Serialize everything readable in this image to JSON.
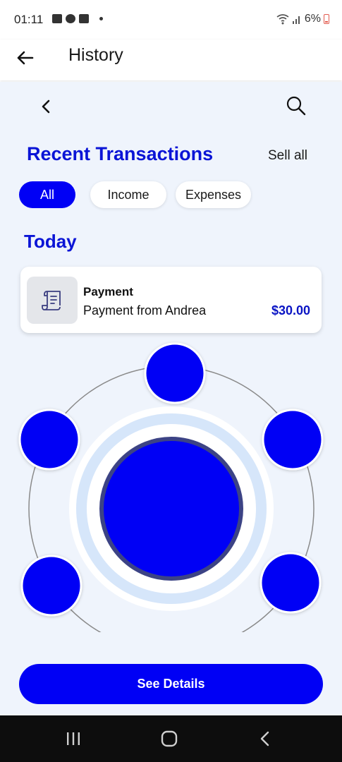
{
  "status": {
    "time": "01:11",
    "battery": "6%",
    "icons": [
      "gallery-icon",
      "a-icon",
      "youtube-icon",
      "dot-icon",
      "wifi-icon",
      "signal-icon",
      "battery-icon"
    ]
  },
  "appbar": {
    "title": "History",
    "back_icon": "arrow-left-icon"
  },
  "content": {
    "section_title": "Recent Transactions",
    "sell_all": "Sell all",
    "filters": [
      {
        "label": "All",
        "active": true
      },
      {
        "label": "Income",
        "active": false
      },
      {
        "label": "Expenses",
        "active": false
      }
    ],
    "group_label": "Today",
    "transactions": [
      {
        "title": "Payment",
        "subtitle": "Payment from Andrea",
        "amount": "$30.00",
        "icon": "receipt-icon"
      }
    ],
    "cta_label": "See Details"
  },
  "colors": {
    "accent": "#0000f5",
    "title_blue": "#0a14d6",
    "background": "#eff4fc",
    "ring_light": "#d6e6fa",
    "center_border": "#3c4385"
  },
  "navbar": {
    "icons": [
      "recent-apps-icon",
      "home-icon",
      "back-icon"
    ]
  }
}
